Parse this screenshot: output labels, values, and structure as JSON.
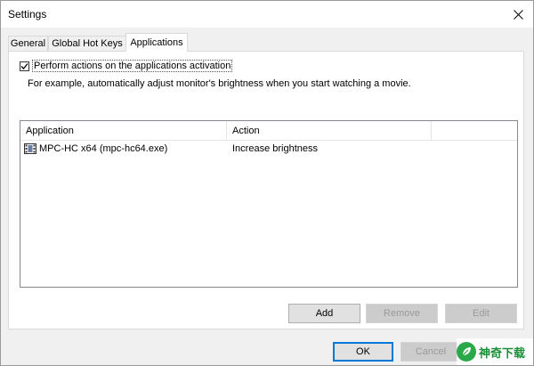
{
  "window": {
    "title": "Settings"
  },
  "tabs": [
    {
      "label": "General"
    },
    {
      "label": "Global Hot Keys"
    },
    {
      "label": "Applications"
    }
  ],
  "applications_tab": {
    "checkbox_label": "Perform actions on the applications activation",
    "checkbox_checked": true,
    "description": "For example, automatically adjust monitor's brightness when you start watching a movie.",
    "columns": [
      "Application",
      "Action"
    ],
    "rows": [
      {
        "application": "MPC-HC x64 (mpc-hc64.exe)",
        "action": "Increase brightness",
        "icon": "film-icon"
      }
    ],
    "buttons": {
      "add": "Add",
      "remove": "Remove",
      "edit": "Edit"
    }
  },
  "dialog_buttons": {
    "ok": "OK",
    "cancel": "Cancel"
  },
  "watermark": {
    "text": "神奇下载",
    "icon": "leaf-badge-icon"
  },
  "colors": {
    "accent": "#0078d7",
    "watermark_green": "#2aa84a"
  }
}
